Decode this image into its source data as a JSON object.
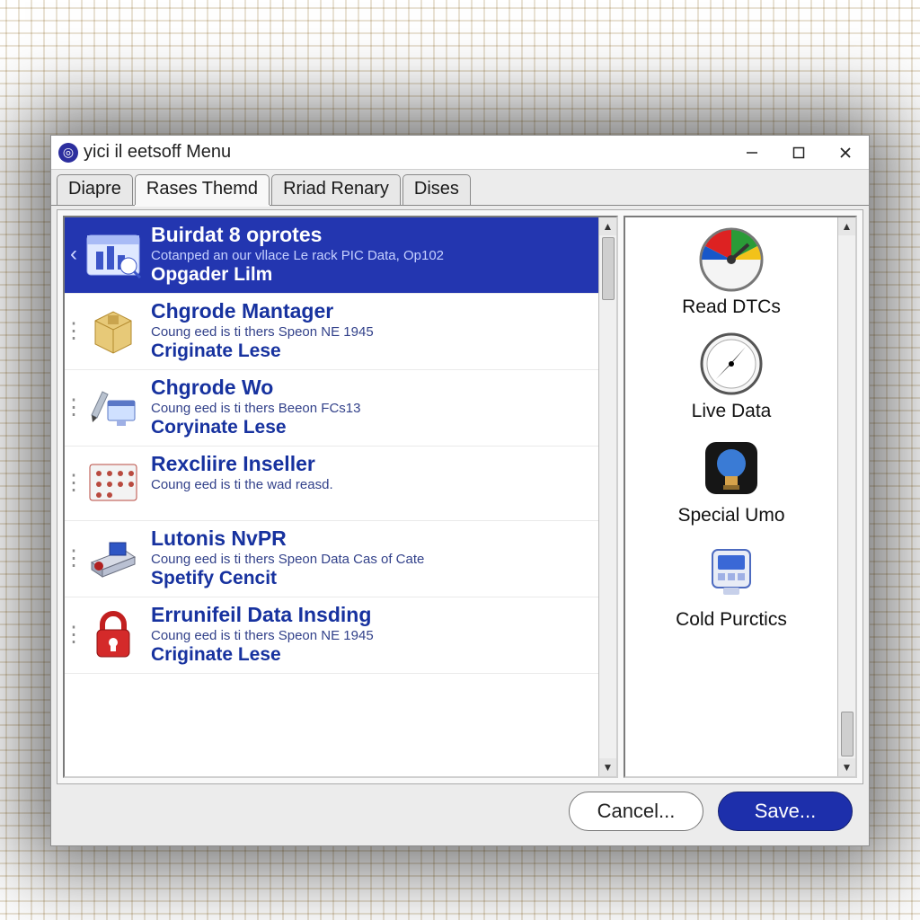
{
  "window": {
    "title": "yici il eetsoff Menu"
  },
  "tabs": [
    {
      "label": "Diapre",
      "active": false
    },
    {
      "label": "Rases Themd",
      "active": true
    },
    {
      "label": "Rriad Renary",
      "active": false
    },
    {
      "label": "Dises",
      "active": false
    }
  ],
  "main_list": [
    {
      "selected": true,
      "icon": "folder-chart-icon",
      "title": "Buirdat 8 oprotes",
      "subtitle": "Cotanped an our vllace Le rack PIC Data, Op102",
      "action": "Opgader Lilm"
    },
    {
      "icon": "box-icon",
      "title": "Chgrode Mantager",
      "subtitle": "Coung eed is ti thers Speon NE 1945",
      "action": "Criginate Lese"
    },
    {
      "icon": "pen-monitor-icon",
      "title": "Chgrode Wo",
      "subtitle": "Coung eed is ti thers Beeon FCs13",
      "action": "Coryinate Lese"
    },
    {
      "icon": "module-grid-icon",
      "title": "Rexcliire Inseller",
      "subtitle": "Coung eed is ti the wad reasd."
    },
    {
      "icon": "scanner-icon",
      "title": "Lutonis NvPR",
      "subtitle": "Coung eed is ti thers Speon Data Cas of Cate",
      "action": "Spetify Cencit"
    },
    {
      "icon": "lock-icon",
      "title": "Errunifeil Data Insding",
      "subtitle": "Coung eed is ti thers Speon NE 1945",
      "action": "Criginate Lese"
    }
  ],
  "side_list": [
    {
      "icon": "gauge-color-icon",
      "label": "Read DTCs"
    },
    {
      "icon": "compass-icon",
      "label": "Live Data"
    },
    {
      "icon": "bulb-icon",
      "label": "Special Umo"
    },
    {
      "icon": "device-icon",
      "label": "Cold Purctics"
    }
  ],
  "footer": {
    "cancel": "Cancel...",
    "save": "Save..."
  }
}
